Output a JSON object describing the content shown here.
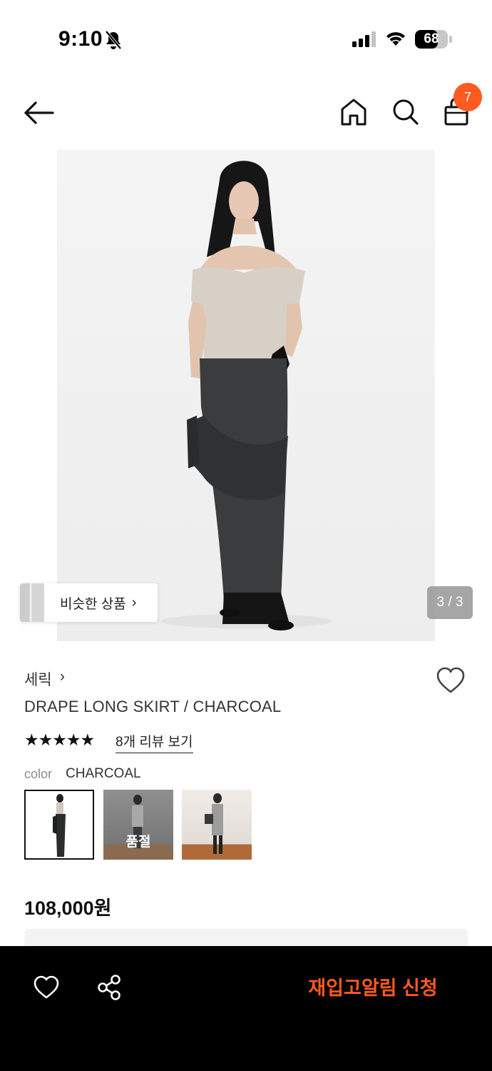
{
  "status_bar": {
    "time": "9:10",
    "battery_level": "68"
  },
  "header": {
    "cart_badge_count": "7"
  },
  "gallery": {
    "similar_products_label": "비슷한 상품",
    "page_counter": "3 / 3"
  },
  "product": {
    "brand": "세릭",
    "title": "DRAPE LONG SKIRT / CHARCOAL",
    "rating_stars": "★★★★★",
    "review_link": "8개 리뷰 보기",
    "color_label": "color",
    "color_value": "CHARCOAL",
    "swatches": [
      {
        "selected": true,
        "sold_out": false
      },
      {
        "selected": false,
        "sold_out": true,
        "badge": "품절"
      },
      {
        "selected": false,
        "sold_out": false
      }
    ],
    "price": "108,000원"
  },
  "bottom_bar": {
    "restock_button_label": "재입고알림 신청"
  },
  "colors": {
    "accent": "#ff5a1f",
    "bottom_bar": "#000000"
  },
  "icons": [
    "bell-off-icon",
    "signal-icon",
    "wifi-icon",
    "back-arrow-icon",
    "home-icon",
    "search-icon",
    "shopping-bag-icon",
    "chevron-right-icon",
    "heart-icon",
    "share-icon"
  ]
}
